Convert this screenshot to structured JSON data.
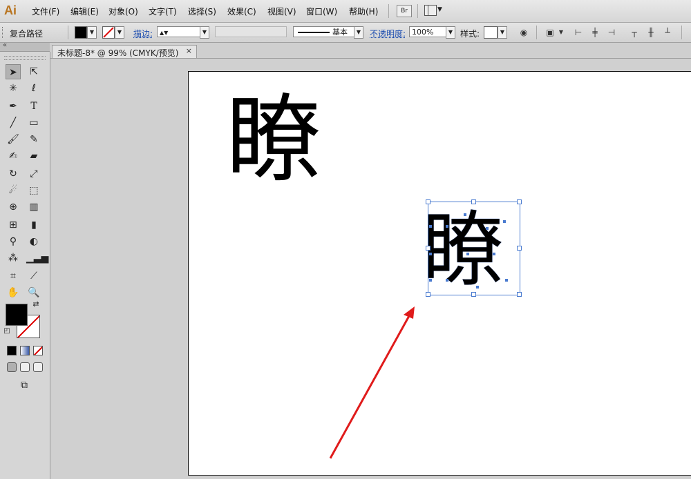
{
  "app": {
    "logo_text": "Ai"
  },
  "menu": {
    "items": [
      "文件(F)",
      "编辑(E)",
      "对象(O)",
      "文字(T)",
      "选择(S)",
      "效果(C)",
      "视图(V)",
      "窗口(W)",
      "帮助(H)"
    ],
    "bridge_label": "Br"
  },
  "control_bar": {
    "selection_type": "复合路径",
    "stroke_label": "描边:",
    "stroke_profile": "基本",
    "opacity_label": "不透明度:",
    "opacity_value": "100%",
    "style_label": "样式:"
  },
  "document": {
    "tab_title": "未标题-8* @ 99% (CMYK/预览)",
    "tab_close": "×"
  },
  "artboard": {
    "text_glyph": "瞭",
    "outlined_glyph": "瞭"
  },
  "toolbox": {
    "collapse_label": "«",
    "tools": [
      "selection",
      "direct-selection",
      "magic-wand",
      "lasso",
      "pen",
      "type",
      "line-segment",
      "rectangle",
      "paintbrush",
      "pencil",
      "blob-brush",
      "eraser",
      "rotate",
      "scale",
      "warp",
      "free-transform",
      "shape-builder",
      "perspective-grid",
      "mesh",
      "gradient",
      "eyedropper",
      "blend",
      "symbol-sprayer",
      "column-graph",
      "artboard",
      "slice",
      "hand",
      "zoom"
    ]
  },
  "colors": {
    "accent_blue": "#4a7bd0",
    "arrow_red": "#e01b1b",
    "brand_orange": "#b8741f"
  }
}
